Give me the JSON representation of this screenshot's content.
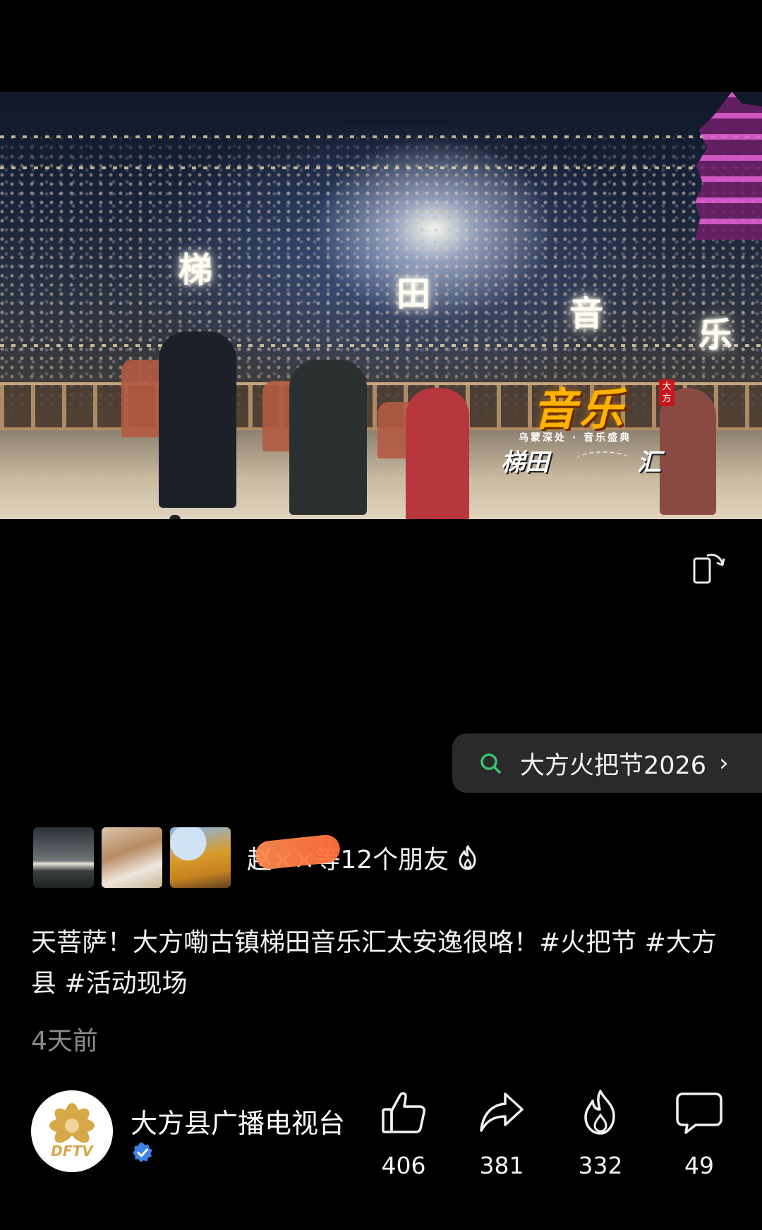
{
  "video": {
    "stage_chars": [
      "梯",
      "田",
      "音",
      "乐"
    ],
    "logo": {
      "main": "音乐",
      "tag": "大方",
      "subtitle": "乌蒙深处 · 音乐盛典",
      "left": "梯田",
      "right": "汇"
    },
    "rotate_icon": "rotate-screen-icon"
  },
  "search": {
    "icon": "search-icon",
    "query": "大方火把节2026",
    "chevron": "›"
  },
  "friends": {
    "text": "赵××等12个朋友",
    "icon": "flame-icon"
  },
  "caption": "天菩萨！大方嘞古镇梯田音乐汇太安逸很咯！#火把节 #大方县 #活动现场",
  "time": "4天前",
  "account": {
    "name": "大方县广播电视台",
    "avatar_text": "DFTV",
    "verified_icon": "verified-badge-icon"
  },
  "actions": {
    "like": {
      "icon": "thumbs-up-icon",
      "count": "406"
    },
    "share": {
      "icon": "share-arrow-icon",
      "count": "381"
    },
    "hot": {
      "icon": "flame-icon",
      "count": "332"
    },
    "comment": {
      "icon": "comment-bubble-icon",
      "count": "49"
    }
  },
  "colors": {
    "background": "#000000",
    "search_icon": "#3cc46a",
    "verified": "#3f82e8",
    "secondary_text": "#8a8a8a",
    "logo_gold": "#ffb300",
    "logo_tag_red": "#c8161d"
  }
}
